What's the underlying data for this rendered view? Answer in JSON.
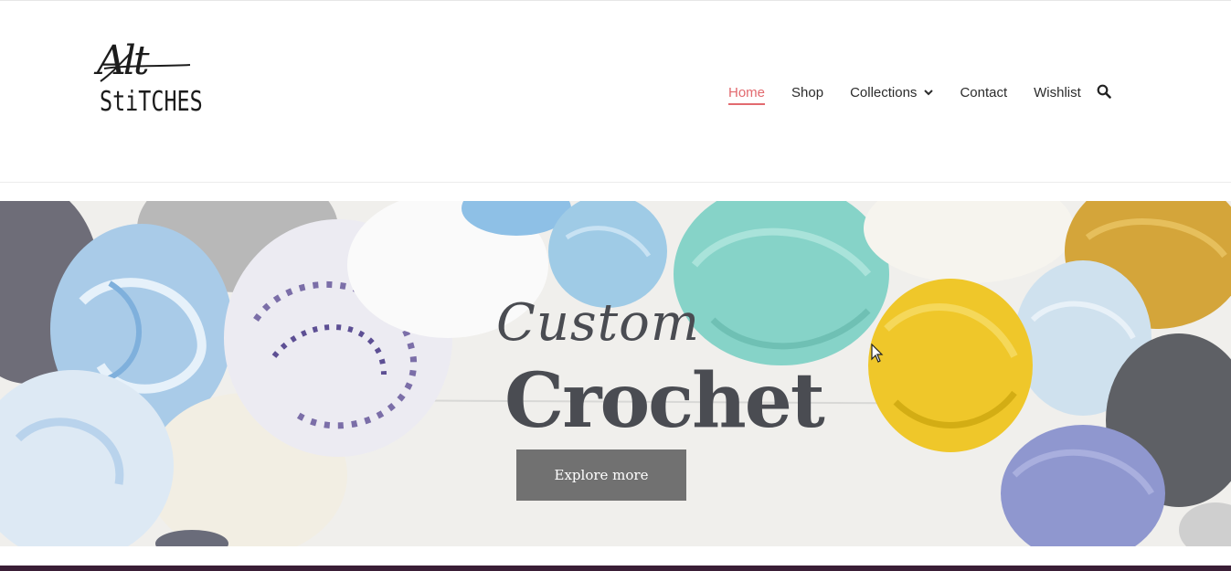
{
  "brand": {
    "logo_script": "Alt",
    "logo_word": "StiTCHES"
  },
  "nav": {
    "items": [
      {
        "label": "Home",
        "active": true
      },
      {
        "label": "Shop"
      },
      {
        "label": "Collections",
        "has_dropdown": true
      },
      {
        "label": "Contact"
      },
      {
        "label": "Wishlist"
      }
    ],
    "search_icon": "search-icon"
  },
  "hero": {
    "kicker": "Custom",
    "title": "Crochet",
    "cta_label": "Explore more"
  },
  "colors": {
    "accent": "#e26a6f",
    "text": "#2b2b2b",
    "hero_text": "#4a4c52",
    "button": "#717171",
    "footer_bar": "#3a1e36"
  }
}
